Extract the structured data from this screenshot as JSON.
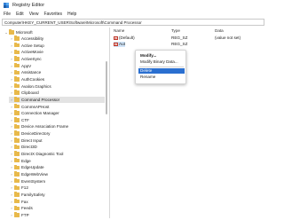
{
  "window": {
    "title": "Registry Editor"
  },
  "menu": [
    "File",
    "Edit",
    "View",
    "Favorites",
    "Help"
  ],
  "address": "Computer\\HKEY_CURRENT_USER\\Software\\Microsoft\\Command Processor",
  "tree": {
    "root": "Microsoft",
    "items": [
      "Accessibility",
      "Active Setup",
      "ActiveMovie",
      "ActiveSync",
      "AppV",
      "Assistance",
      "AuthCookies",
      "Avalon.Graphics",
      "Clipboard",
      "Command Processor",
      "CommsAPHost",
      "Connection Manager",
      "CTF",
      "Device Association Frame",
      "DeviceDirectory",
      "Direct Input",
      "Direct3D",
      "DirectX Diagnostic Tool",
      "Edge",
      "EdgeUpdate",
      "EdgeWebView",
      "EventSystem",
      "F12",
      "FamilySafety",
      "Fax",
      "Feeds",
      "FTP"
    ],
    "selected": "Command Processor"
  },
  "list": {
    "columns": {
      "name": "Name",
      "type": "Type",
      "data": "Data"
    },
    "rows": [
      {
        "name": "(Default)",
        "type": "REG_SZ",
        "data": "(value not set)"
      },
      {
        "name": "Aut",
        "type": "REG_SZ",
        "data": ""
      }
    ]
  },
  "context_menu": {
    "modify": "Modify...",
    "modify_binary": "Modify Binary Data...",
    "delete": "Delete",
    "rename": "Rename"
  },
  "colors": {
    "folder": "#e8b94b",
    "highlight": "#2a6fd0",
    "selection": "#e3e3e3"
  }
}
